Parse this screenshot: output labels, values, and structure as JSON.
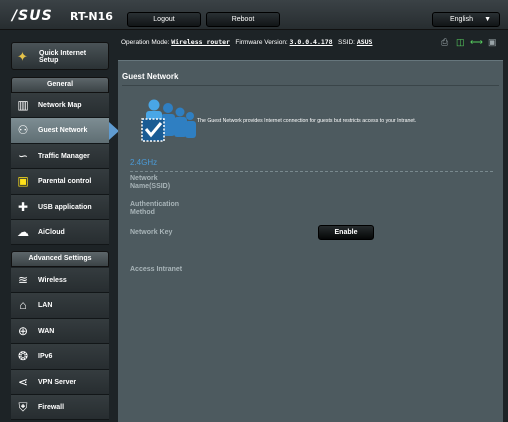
{
  "app": {
    "logo": "/SUS",
    "model": "RT-N16"
  },
  "topbar": {
    "logout_label": "Logout",
    "reboot_label": "Reboot",
    "language": "English"
  },
  "status": {
    "mode_label": "Operation Mode:",
    "mode_value": "Wireless router",
    "firmware_label": "Firmware Version:",
    "firmware_value": "3.0.0.4.178",
    "ssid_label": "SSID:",
    "ssid_value": "ASUS",
    "icons": [
      "printer-icon",
      "usb-icon",
      "network-icon",
      "storage-icon"
    ]
  },
  "quick_setup": {
    "label": "Quick Internet Setup",
    "icon": "wand-icon"
  },
  "sidebar": {
    "general_title": "General",
    "general_items": [
      {
        "label": "Network Map",
        "icon": "network-map-icon",
        "active": false
      },
      {
        "label": "Guest Network",
        "icon": "guest-network-icon",
        "active": true
      },
      {
        "label": "Traffic Manager",
        "icon": "traffic-manager-icon",
        "active": false
      },
      {
        "label": "Parental control",
        "icon": "parental-control-icon",
        "active": false
      },
      {
        "label": "USB application",
        "icon": "puzzle-icon",
        "active": false
      },
      {
        "label": "AiCloud",
        "icon": "cloud-icon",
        "active": false
      }
    ],
    "advanced_title": "Advanced Settings",
    "advanced_items": [
      {
        "label": "Wireless",
        "icon": "wifi-icon"
      },
      {
        "label": "LAN",
        "icon": "home-icon"
      },
      {
        "label": "WAN",
        "icon": "globe-icon"
      },
      {
        "label": "IPv6",
        "icon": "ipv6-icon"
      },
      {
        "label": "VPN Server",
        "icon": "vpn-icon"
      },
      {
        "label": "Firewall",
        "icon": "shield-icon"
      }
    ]
  },
  "main": {
    "title": "Guest Network",
    "intro": "The Guest Network provides Internet connection for guests but restricts access to your Intranet.",
    "band": "2.4GHz",
    "fields": {
      "ssid_label": "Network Name(SSID)",
      "auth_label": "Authentication Method",
      "key_label": "Network Key",
      "intranet_label": "Access Intranet"
    },
    "enable_label": "Enable"
  },
  "colors": {
    "accent_blue": "#4a9ad6",
    "panel": "#4d5a5f",
    "active_item": "#7d8d93"
  }
}
